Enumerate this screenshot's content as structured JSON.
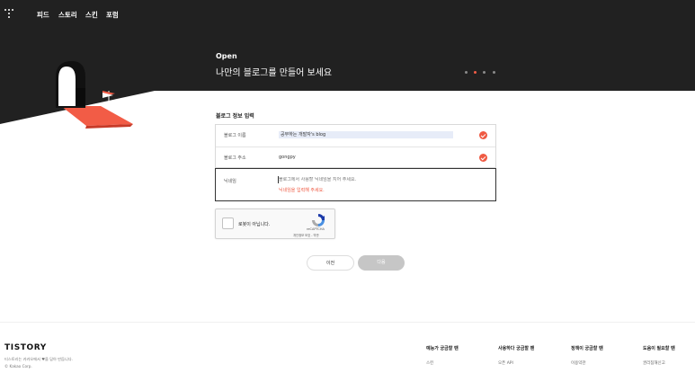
{
  "nav": {
    "items": [
      "피드",
      "스토리",
      "스킨",
      "포럼"
    ]
  },
  "hero": {
    "title": "Open",
    "subtitle": "나만의 블로그를 만들어 보세요",
    "step_active": 2,
    "step_total": 4
  },
  "form": {
    "section_title": "블로그 정보 입력",
    "name": {
      "label": "블로그 이름",
      "value": "공부하는 개발자's blog"
    },
    "address": {
      "label": "블로그 주소",
      "value": "gongpy"
    },
    "nickname": {
      "label": "닉네임",
      "placeholder": "블로그에서 사용할 닉네임을 지어 주세요.",
      "error": "닉네임을 입력해 주세요."
    }
  },
  "recaptcha": {
    "label": "로봇이 아닙니다.",
    "brand": "reCAPTCHA",
    "links": "개인정보 보호 - 약관"
  },
  "buttons": {
    "prev": "이전",
    "next": "다음"
  },
  "footer": {
    "logo": "TISTORY",
    "description": "티스토리는 카카오에서 ♥을 담아 만듭니다.",
    "copyright": "© Kakao Corp.",
    "columns": [
      {
        "title": "예능가 궁금할 땐",
        "link": "스킨"
      },
      {
        "title": "사용하다 궁금할 땐",
        "link": "오픈 API"
      },
      {
        "title": "정책이 궁금할 땐",
        "link": "이용약관"
      },
      {
        "title": "도움이 필요할 땐",
        "link": "권리침해신고"
      }
    ]
  },
  "colors": {
    "dark": "#212121",
    "accent": "#ef5a43",
    "hero_accent": "#f25c46"
  }
}
